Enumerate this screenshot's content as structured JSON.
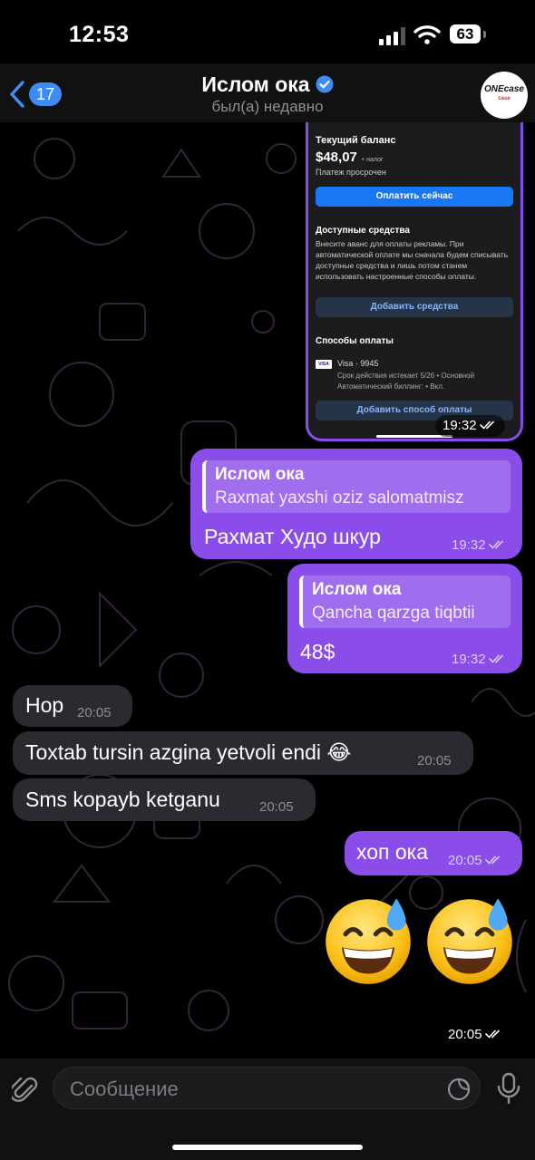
{
  "status_bar": {
    "time": "12:53",
    "battery": "63"
  },
  "header": {
    "back_count": "17",
    "title": "Ислом ока",
    "subtitle": "был(а) недавно",
    "avatar_text": "ONEcase",
    "avatar_sub": "case"
  },
  "screenshot_message": {
    "balance_title": "Текущий баланс",
    "amount": "$48,07",
    "tax": "+ налог",
    "overdue": "Платеж просрочен",
    "pay_now": "Оплатить сейчас",
    "funds_title": "Доступные средства",
    "funds_text": "Внесите аванс для оплаты рекламы. При автоматической оплате мы сначала будем списывать доступные средства и лишь потом станем использовать настроенные способы оплаты.",
    "add_funds": "Добавить средства",
    "methods_title": "Способы оплаты",
    "visa_logo": "VISA",
    "visa": "Visa · 9945",
    "visa_detail": "Срок действия истекает 5/26 • Основной Автоматический биллинг: • Вкл.",
    "add_method": "Добавить способ оплаты",
    "time": "19:32"
  },
  "messages": [
    {
      "quote_name": "Ислом ока",
      "quote_text": "Raxmat yaxshi oziz salomatmisz",
      "text": "Рахмат Худо шкур",
      "time": "19:32"
    },
    {
      "quote_name": "Ислом ока",
      "quote_text": "Qancha qarzga tiqbtii",
      "text": "48$",
      "time": "19:32"
    },
    {
      "text": "Hop",
      "time": "20:05"
    },
    {
      "text": "Toxtab tursin azgina yetvoli endi 😂",
      "time": "20:05"
    },
    {
      "text": "Sms kopayb ketganu",
      "time": "20:05"
    },
    {
      "text": "хоп ока",
      "time": "20:05"
    }
  ],
  "emoji_message": {
    "emoji": "😅😅",
    "time": "20:05"
  },
  "input": {
    "placeholder": "Сообщение"
  },
  "colors": {
    "outgoing": "#8a4dea",
    "incoming": "#2c2a31",
    "accent": "#3d8cf6"
  },
  "icons": [
    "back-chevron-icon",
    "verified-icon",
    "attach-icon",
    "sticker-icon",
    "mic-icon",
    "read-ticks-icon",
    "signal-icon",
    "wifi-icon",
    "battery-icon"
  ]
}
